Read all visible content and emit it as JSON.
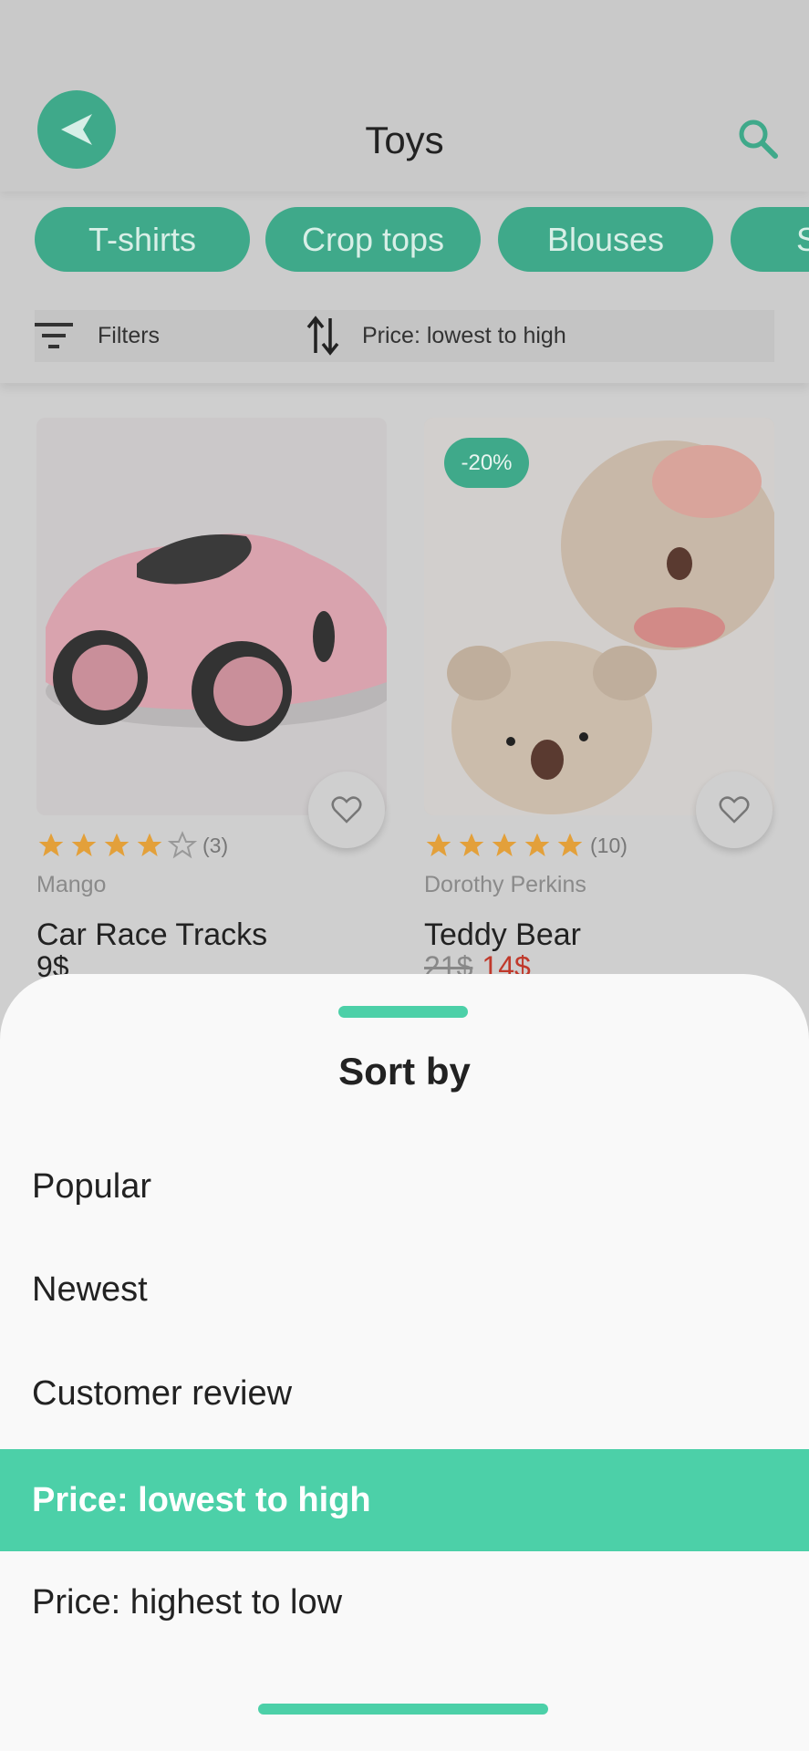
{
  "header": {
    "title": "Toys",
    "back_icon": "back-arrow-icon",
    "search_icon": "search-icon"
  },
  "categories": [
    "T-shirts",
    "Crop tops",
    "Blouses",
    "S"
  ],
  "toolbar": {
    "filters_label": "Filters",
    "sort_label": "Price: lowest to high"
  },
  "products": [
    {
      "name": "Car Race Tracks",
      "brand": "Mango",
      "rating": 4,
      "reviews": "(3)",
      "price": "9$"
    },
    {
      "name": "Teddy Bear",
      "brand": "Dorothy Perkins",
      "rating": 5,
      "reviews": "(10)",
      "discount": "-20%",
      "old_price": "21$",
      "new_price": "14$"
    }
  ],
  "sort_sheet": {
    "title": "Sort by",
    "options": [
      "Popular",
      "Newest",
      "Customer review",
      "Price: lowest to high",
      "Price: highest to low"
    ],
    "selected": "Price: lowest to high"
  },
  "colors": {
    "accent": "#4cd0a8",
    "accent_dimmed": "#3fa98a",
    "star": "#f0a030",
    "sale_price": "#c0392b"
  }
}
